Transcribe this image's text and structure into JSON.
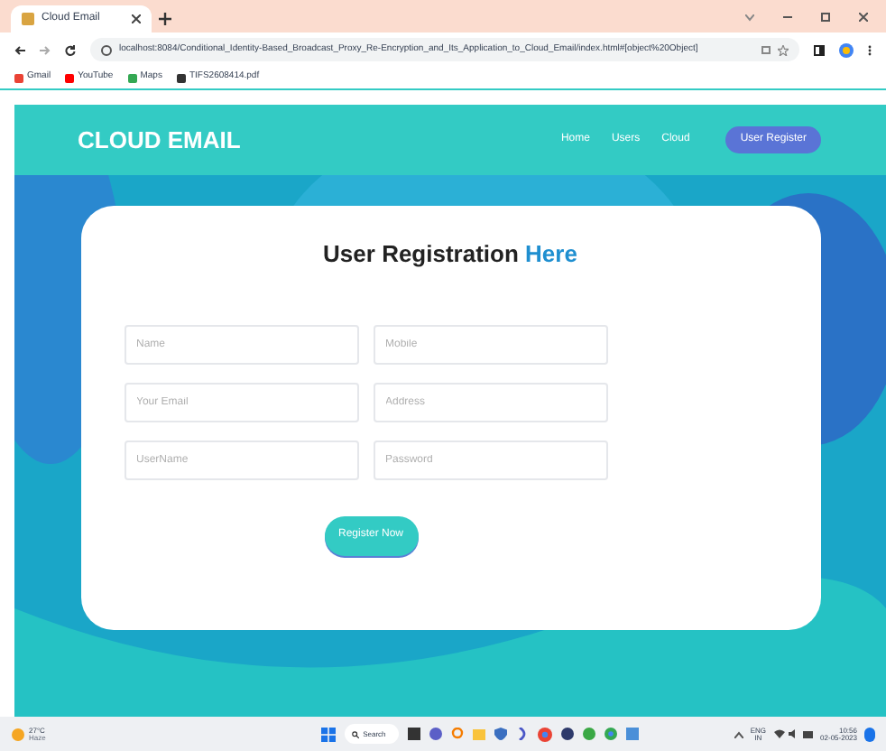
{
  "browser": {
    "tab": {
      "title": "Cloud Email",
      "selected": true
    },
    "url": "localhost:8084/Conditional_Identity-Based_Broadcast_Proxy_Re-Encryption_and_Its_Application_to_Cloud_Email/index.html#[object%20Object]",
    "bookmarks": [
      {
        "label": "Gmail",
        "color": "#ea4335"
      },
      {
        "label": "YouTube",
        "color": "#ff0000"
      },
      {
        "label": "Maps",
        "color": "#34a853"
      },
      {
        "label": "TIFS2608414.pdf",
        "color": "#333333"
      }
    ]
  },
  "navbar": {
    "brand": "CLOUD EMAIL",
    "links": [
      {
        "label": "Home",
        "selected": false
      },
      {
        "label": "Users",
        "selected": false
      },
      {
        "label": "Cloud",
        "selected": false
      },
      {
        "label": "User Register",
        "selected": true
      }
    ]
  },
  "form": {
    "title": "User Registration",
    "title_highlight": "Here",
    "fields": [
      {
        "placeholder": "Name"
      },
      {
        "placeholder": "Mobile"
      },
      {
        "placeholder": "Your Email"
      },
      {
        "placeholder": "Address"
      },
      {
        "placeholder": "UserName"
      },
      {
        "placeholder": "Password"
      }
    ],
    "submit": "Register Now"
  },
  "taskbar": {
    "weather": "27°C",
    "weather_note": "Haze",
    "search": "Search",
    "lang": "ENG",
    "lang_region": "IN",
    "time": "10:56",
    "date": "02-05-2023"
  }
}
